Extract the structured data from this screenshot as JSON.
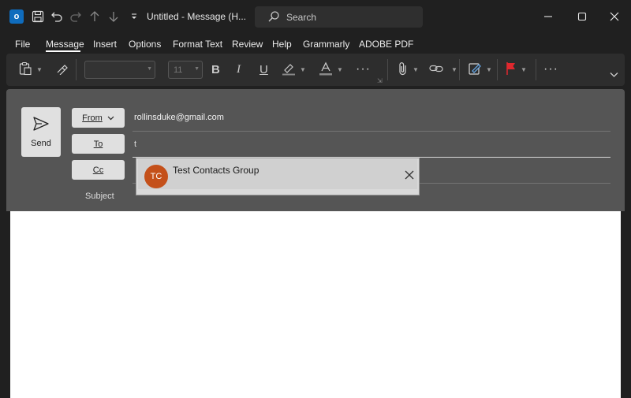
{
  "titlebar": {
    "window_title": "Untitled  -  Message (H...",
    "search_placeholder": "Search",
    "app_logo_letter": "o"
  },
  "menu": {
    "items": [
      "File",
      "Message",
      "Insert",
      "Options",
      "Format Text",
      "Review",
      "Help",
      "Grammarly",
      "ADOBE PDF"
    ],
    "active": "Message"
  },
  "ribbon": {
    "font_size_value": "11"
  },
  "compose": {
    "send_label": "Send",
    "from_label": "From",
    "from_value": "rollinsduke@gmail.com",
    "to_label": "To",
    "to_value": "t",
    "cc_label": "Cc",
    "subject_label": "Subject"
  },
  "suggestion": {
    "initials": "TC",
    "name": "Test Contacts Group",
    "avatar_color": "#c4501a"
  },
  "colors": {
    "titlebar_bg": "#202020",
    "ribbon_bg": "#2d2d2d",
    "header_bg": "#555555",
    "flag_red": "#e0282e",
    "outlook_blue": "#0f6cbd"
  }
}
